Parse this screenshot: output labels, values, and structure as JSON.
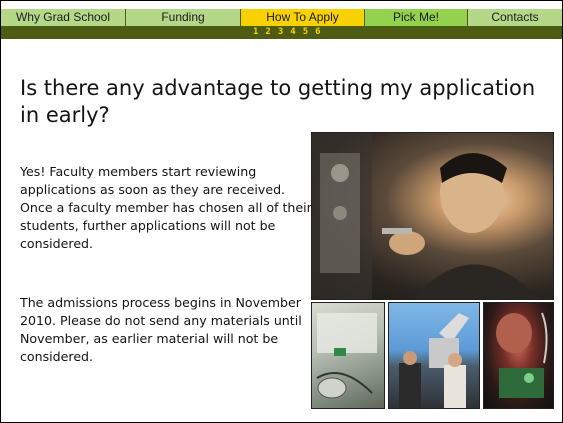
{
  "nav": {
    "tabs": [
      {
        "label": "Why Grad School",
        "active": false
      },
      {
        "label": "Funding",
        "active": false
      },
      {
        "label": "How To Apply",
        "active": true
      },
      {
        "label": "Pick Me!",
        "active": false
      },
      {
        "label": "Contacts",
        "active": false
      }
    ],
    "steps": [
      "1",
      "2",
      "3",
      "4",
      "5",
      "6"
    ]
  },
  "content": {
    "title": "Is there any advantage to getting my application in early?",
    "paragraph1": "Yes! Faculty members start reviewing applications as soon as they are received. Once a faculty member has chosen all of their students, further applications will not be considered.",
    "paragraph2": "The admissions process begins in November 2010. Please do not send any materials until November, as earlier material will not be considered."
  },
  "colors": {
    "tab_bg": "#b4d888",
    "tab_active_bg": "#f7d200",
    "tab_pick_bg": "#93d24e",
    "subbar_bg": "#4e5b12",
    "step_color": "#f7d200"
  },
  "images": [
    {
      "name": "student-with-equipment-photo"
    },
    {
      "name": "lab-workbench-photo"
    },
    {
      "name": "researchers-with-robot-photo"
    },
    {
      "name": "circuit-board-photo"
    }
  ]
}
